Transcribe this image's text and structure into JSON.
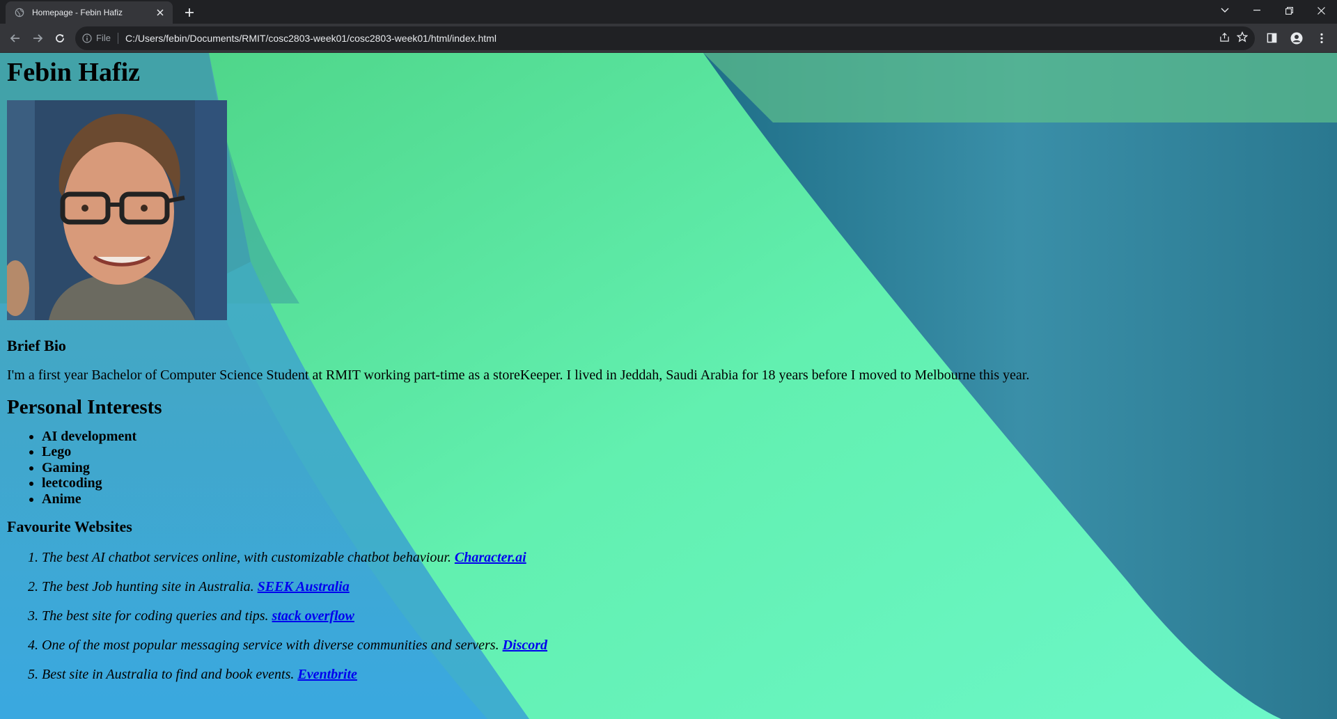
{
  "browser": {
    "tab": {
      "title": "Homepage - Febin Hafiz"
    },
    "omnibox": {
      "scheme_label": "File",
      "url": "C:/Users/febin/Documents/RMIT/cosc2803-week01/cosc2803-week01/html/index.html"
    }
  },
  "page": {
    "name": "Febin Hafiz",
    "bio_heading": "Brief Bio",
    "bio_text": "I'm a first year Bachelor of Computer Science Student at RMIT working part-time as a storeKeeper. I lived in Jeddah, Saudi Arabia for 18 years before I moved to Melbourne this year.",
    "interests_heading": "Personal Interests",
    "interests": [
      "AI development",
      "Lego",
      "Gaming",
      "leetcoding",
      "Anime"
    ],
    "websites_heading": "Favourite Websites",
    "websites": [
      {
        "text": "The best AI chatbot services online, with customizable chatbot behaviour.",
        "link": "Character.ai"
      },
      {
        "text": "The best Job hunting site in Australia.",
        "link": "SEEK Australia"
      },
      {
        "text": "The best site for coding queries and tips.",
        "link": "stack overflow"
      },
      {
        "text": "One of the most popular messaging service with diverse communities and servers.",
        "link": "Discord"
      },
      {
        "text": "Best site in Australia to find and book events.",
        "link": "Eventbrite"
      }
    ]
  },
  "colors": {
    "chrome_dark": "#202124",
    "chrome_toolbar": "#35363a",
    "link": "#0000ee",
    "bg_green": "#5fe08a",
    "bg_teal": "#2e8aa0",
    "bg_blue": "#3ab4d6"
  }
}
